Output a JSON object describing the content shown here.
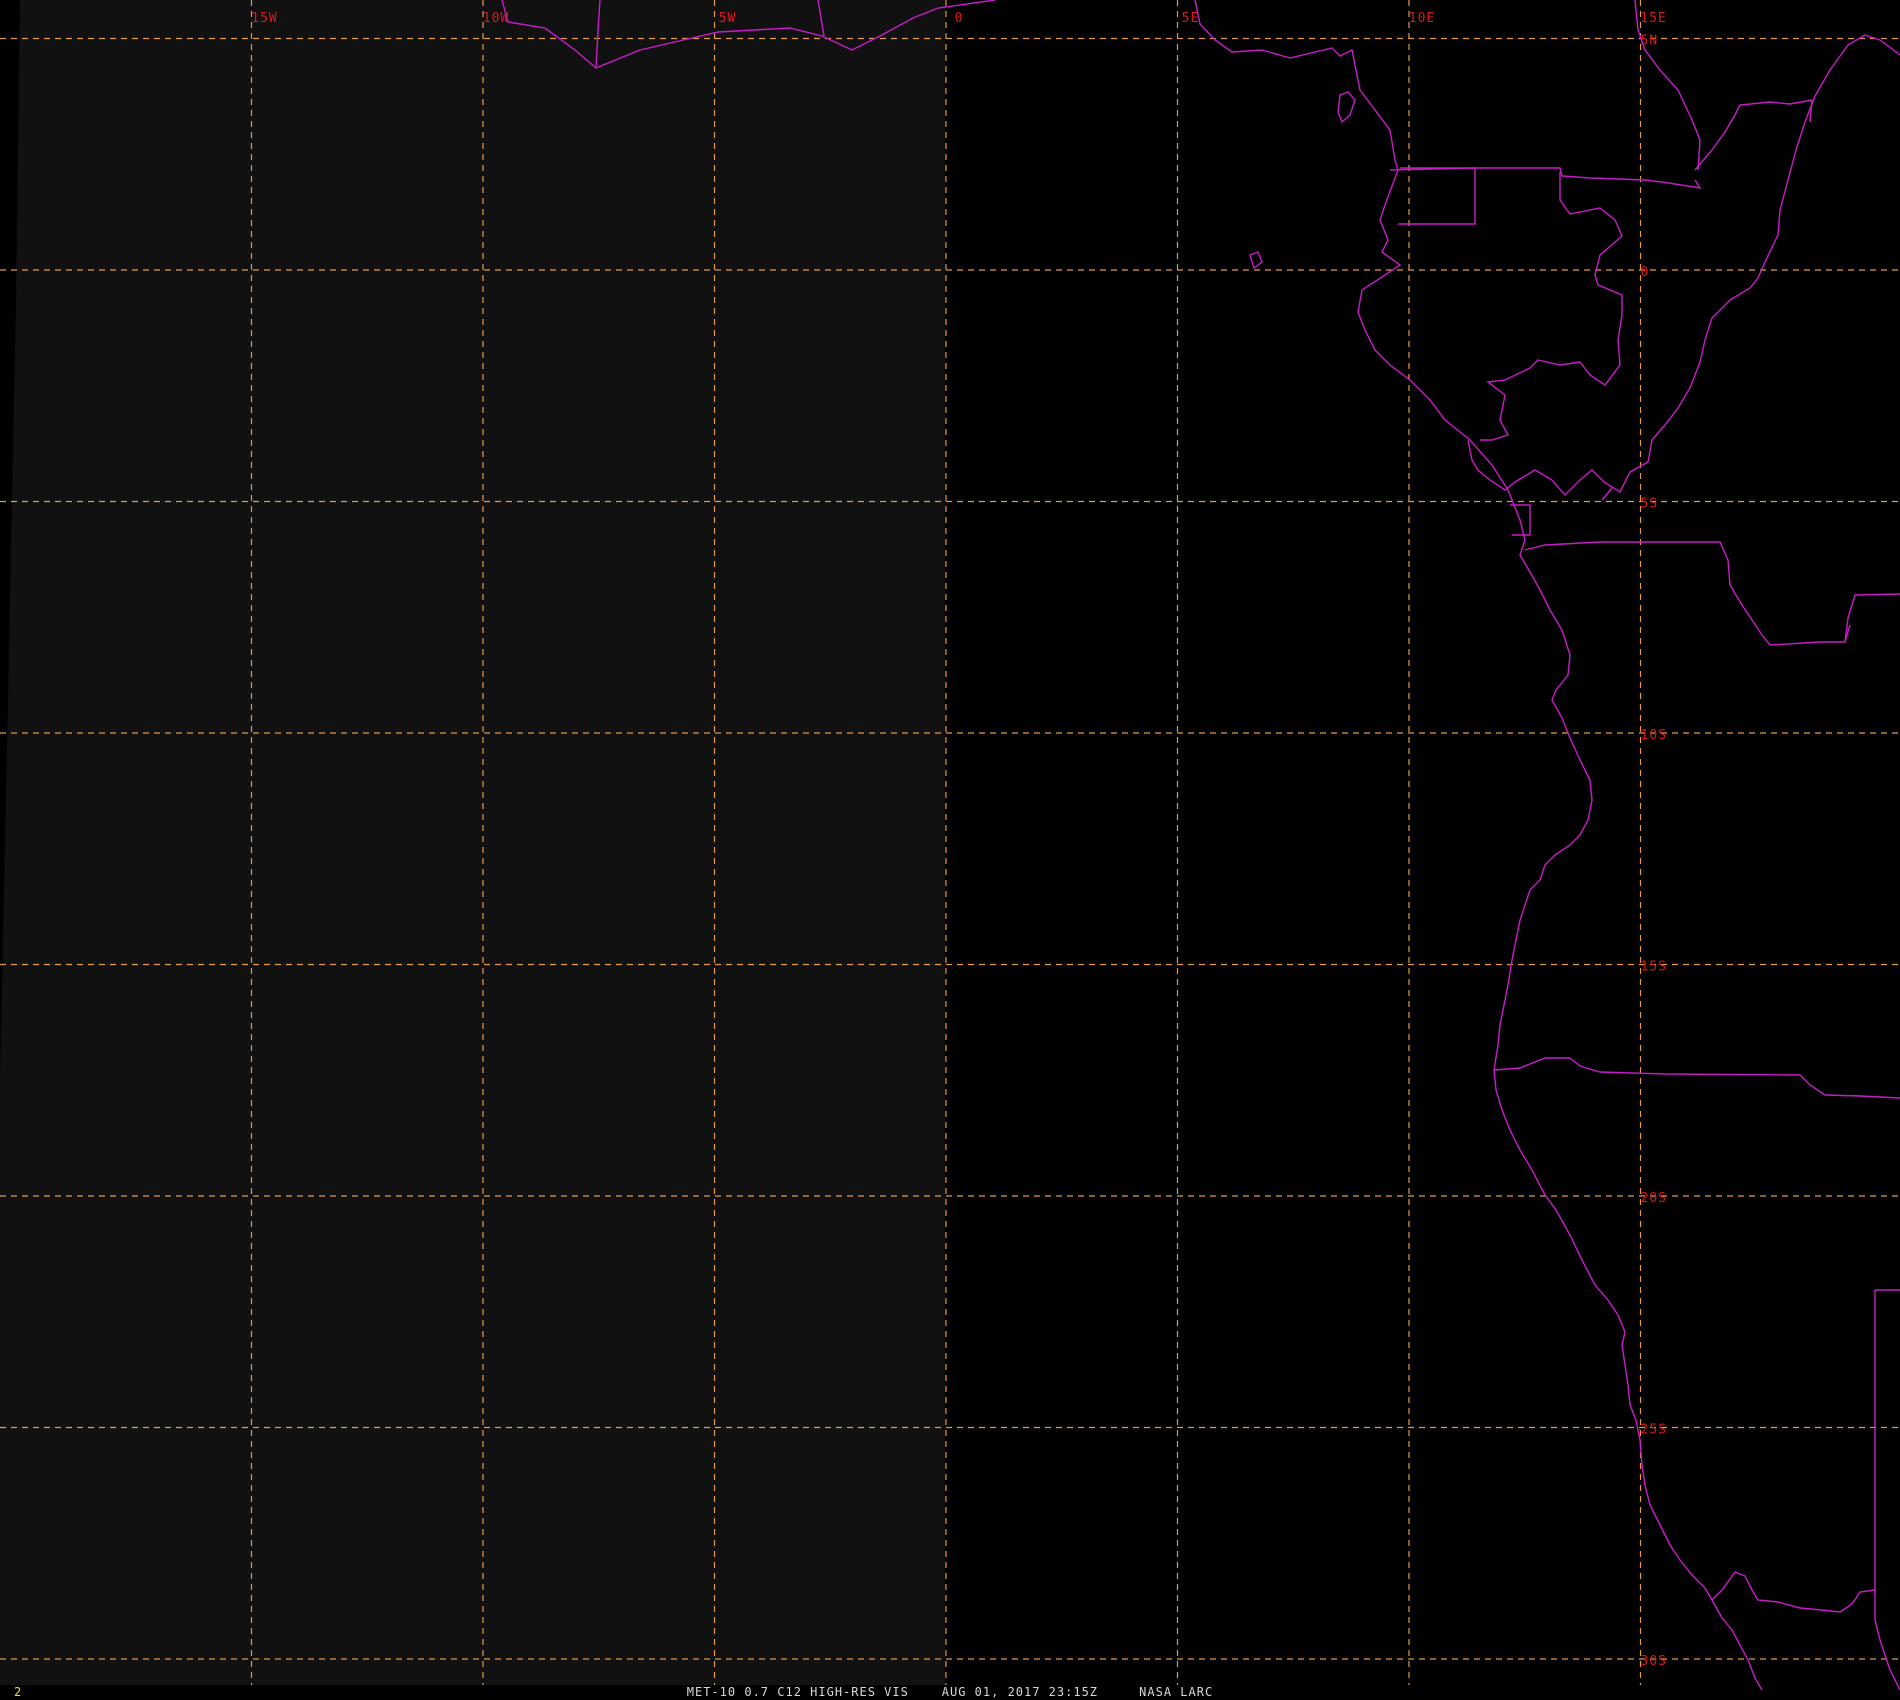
{
  "map": {
    "colors": {
      "background": "#000000",
      "dayside": "#111111",
      "grid": "#e39a4a",
      "label": "#d91a1a",
      "coastline": "#c81cc8"
    },
    "lon_lines": [
      {
        "lon": -15,
        "label": "15W"
      },
      {
        "lon": -10,
        "label": "10W"
      },
      {
        "lon": -5,
        "label": "5W"
      },
      {
        "lon": 0,
        "label": "0"
      },
      {
        "lon": 5,
        "label": "5E"
      },
      {
        "lon": 10,
        "label": "10E"
      },
      {
        "lon": 15,
        "label": "15E"
      }
    ],
    "lat_lines": [
      {
        "lat": 5,
        "label": "5N"
      },
      {
        "lat": 0,
        "label": "0"
      },
      {
        "lat": -5,
        "label": "5S"
      },
      {
        "lat": -10,
        "label": "10S"
      },
      {
        "lat": -15,
        "label": "15S"
      },
      {
        "lat": -20,
        "label": "20S"
      },
      {
        "lat": -25,
        "label": "25S"
      },
      {
        "lat": -30,
        "label": "30S"
      }
    ]
  },
  "status": {
    "frame_number": "2",
    "product": "MET-10 0.7 C12 HIGH-RES VIS",
    "datetime": "AUG 01, 2017 23:15Z",
    "source": "NASA LARC"
  }
}
